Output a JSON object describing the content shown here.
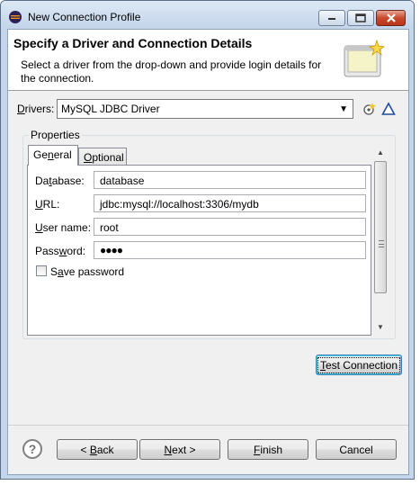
{
  "window": {
    "title": "New Connection Profile",
    "app_icon": "eclipse-icon"
  },
  "header": {
    "title": "Specify a Driver and Connection Details",
    "description": "Select a driver from the drop-down and provide login details for the connection.",
    "graphic": "connection-wizard-banner"
  },
  "drivers": {
    "label_mnemonic": "D",
    "label_rest": "rivers:",
    "selected": "MySQL JDBC Driver",
    "new_driver_icon": "new-driver-icon",
    "edit_driver_icon": "edit-driver-icon"
  },
  "properties": {
    "group_title": "Properties",
    "tabs": [
      {
        "pre": "Ge",
        "mn": "n",
        "post": "eral",
        "active": true
      },
      {
        "pre": "",
        "mn": "O",
        "post": "ptional",
        "active": false
      }
    ],
    "fields": {
      "database": {
        "pre": "Da",
        "mn": "t",
        "post": "abase:",
        "value": "database"
      },
      "url": {
        "pre": "",
        "mn": "U",
        "post": "RL:",
        "value": "jdbc:mysql://localhost:3306/mydb"
      },
      "username": {
        "pre": "",
        "mn": "U",
        "post": "ser name:",
        "value": "root"
      },
      "password": {
        "pre": "Pass",
        "mn": "w",
        "post": "ord:",
        "value": "●●●●"
      }
    },
    "save_password": {
      "pre": "S",
      "mn": "a",
      "post": "ve password",
      "checked": false
    }
  },
  "buttons": {
    "test_connection": {
      "pre": "",
      "mn": "T",
      "post": "est Connection"
    },
    "back": {
      "pre": "< ",
      "mn": "B",
      "post": "ack"
    },
    "next": {
      "pre": "",
      "mn": "N",
      "post": "ext >"
    },
    "finish": {
      "pre": "",
      "mn": "F",
      "post": "inish"
    },
    "cancel": {
      "label": "Cancel"
    }
  },
  "help": {
    "glyph": "?"
  }
}
